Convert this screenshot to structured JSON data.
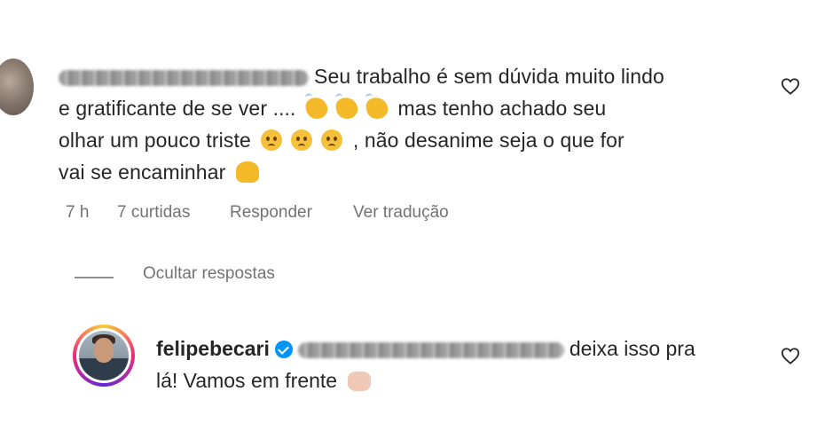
{
  "comment": {
    "text_line1": "Seu trabalho é sem dúvida muito lindo",
    "text_line2a": "e gratificante de se ver ....",
    "text_line2b": "mas tenho achado seu",
    "text_line3a": "olhar um pouco triste",
    "text_line3b": ", não desanime seja o que for",
    "text_line4": "vai se encaminhar",
    "time": "7 h",
    "likes": "7 curtidas",
    "reply_label": "Responder",
    "translate_label": "Ver tradução"
  },
  "hide_replies_label": "Ocultar respostas",
  "reply": {
    "username": "felipebecari",
    "text_line1": "deixa isso pra",
    "text_line2": "lá! Vamos em frente"
  },
  "icons": {
    "like": "heart-icon",
    "verified": "verified-badge-icon",
    "clap": "clapping-hands-emoji",
    "sad": "pleading-face-emoji",
    "raised_hands": "raising-hands-emoji",
    "fist": "oncoming-fist-emoji"
  },
  "colors": {
    "text": "#262626",
    "secondary": "#737373",
    "verified": "#0095f6"
  }
}
